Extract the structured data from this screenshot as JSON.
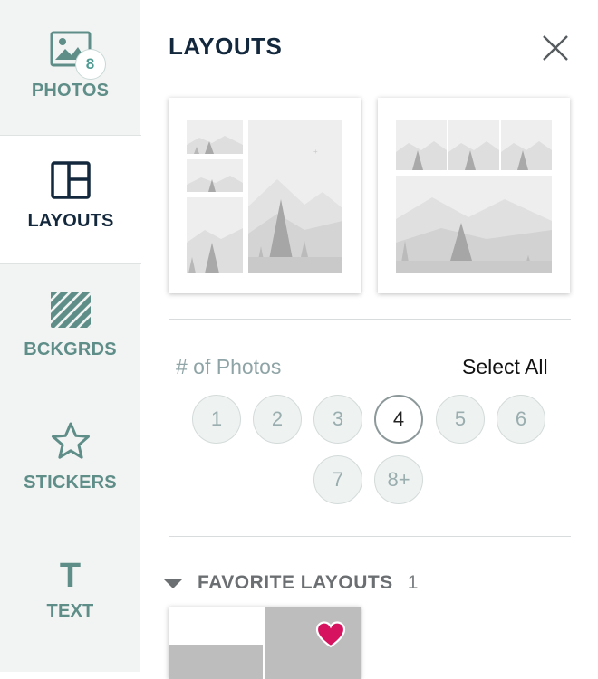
{
  "sidebar": {
    "photos": {
      "label": "PHOTOS",
      "badge": "8",
      "icon": "image-icon"
    },
    "layouts": {
      "label": "LAYOUTS",
      "icon": "layout-icon"
    },
    "backgrounds": {
      "label": "BCKGRDS",
      "icon": "background-pattern-icon"
    },
    "stickers": {
      "label": "STICKERS",
      "icon": "star-icon"
    },
    "text": {
      "label": "TEXT",
      "glyph": "T",
      "icon": "text-icon"
    }
  },
  "panel": {
    "title": "LAYOUTS",
    "close_icon": "close-icon",
    "photo_count_label": "# of Photos",
    "select_all": "Select All",
    "photo_counts": [
      "1",
      "2",
      "3",
      "4",
      "5",
      "6",
      "7",
      "8+"
    ],
    "selected_count": "4",
    "favorites": {
      "title": "FAVORITE LAYOUTS",
      "count": "1"
    }
  },
  "colors": {
    "active_text": "#13283c",
    "sidebar_text": "#5f8d88",
    "sidebar_bg": "#f1f4f3",
    "heart": "#d6135e"
  }
}
